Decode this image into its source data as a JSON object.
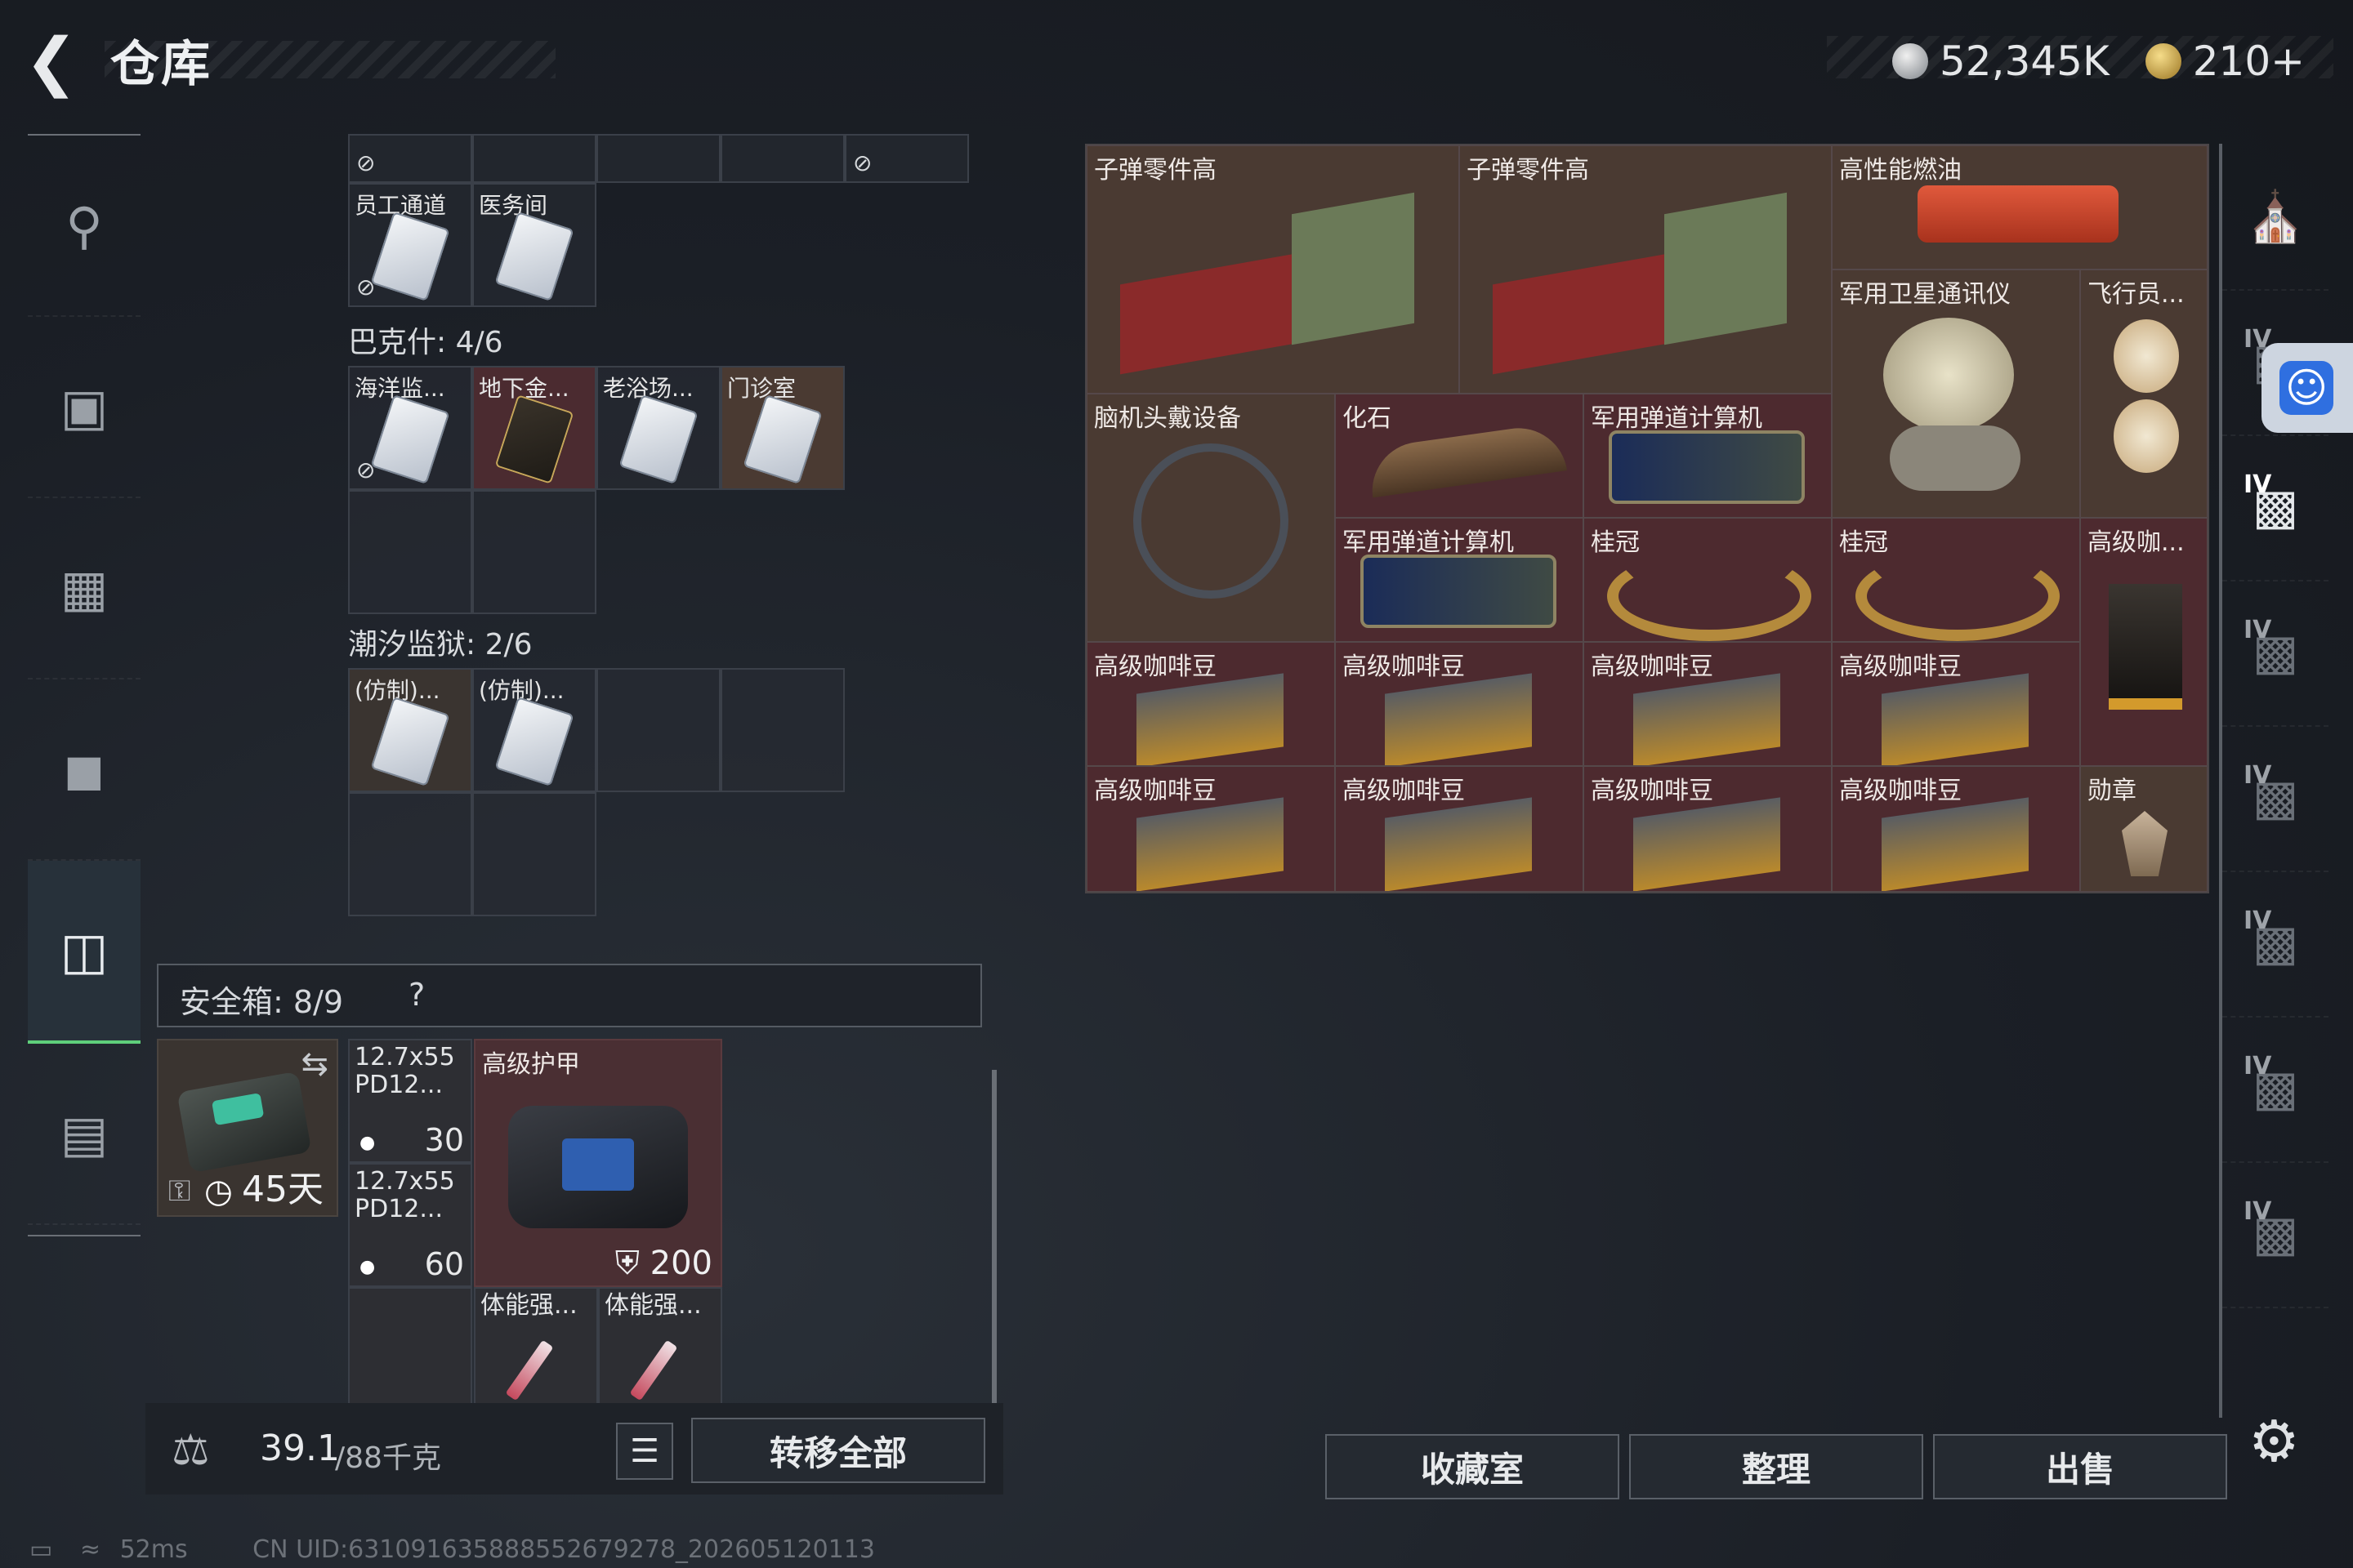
{
  "header": {
    "title": "仓库",
    "currency_silver": "52,345K",
    "currency_gold": "210+"
  },
  "left_nav": {
    "icons": [
      "rifle-icon",
      "armor-vest-icon",
      "chest-rig-icon",
      "backpack-icon",
      "storage-case-icon",
      "briefcase-icon"
    ]
  },
  "storage": {
    "row1_labels": [
      "员工通道",
      "医务间"
    ],
    "bakeshi_title": "巴克什: 4/6",
    "bakeshi_items": [
      "海洋监...",
      "地下金...",
      "老浴场...",
      "门诊室"
    ],
    "prison_title": "潮汐监狱: 2/6",
    "prison_items": [
      "(仿制)...",
      "(仿制)..."
    ]
  },
  "safe": {
    "label": "安全箱: 8/9",
    "help": "?",
    "days": "45天"
  },
  "inventory": {
    "ammo1_label": "12.7x55 PD12...",
    "ammo1_count": "30",
    "ammo2_label": "12.7x55 PD12...",
    "ammo2_count": "60",
    "armor_label": "高级护甲",
    "armor_value": "200",
    "stim1": "体能强...",
    "stim2": "体能强..."
  },
  "footer_left": {
    "weight_current": "39.1",
    "weight_max": "/88千克",
    "transfer_all": "转移全部"
  },
  "collection": {
    "items": [
      "子弹零件高",
      "子弹零件高",
      "高性能燃油",
      "军用卫星通讯仪",
      "飞行员...",
      "脑机头戴设备",
      "化石",
      "军用弹道计算机",
      "军用弹道计算机",
      "桂冠",
      "桂冠",
      "高级咖...",
      "高级咖啡豆",
      "高级咖啡豆",
      "高级咖啡豆",
      "高级咖啡豆",
      "高级咖啡豆",
      "高级咖啡豆",
      "高级咖啡豆",
      "高级咖啡豆",
      "勋章"
    ]
  },
  "right_tabs": {
    "level": "IV",
    "icons": [
      "shelter-icon",
      "vault-IV-icon",
      "vault-IV-icon",
      "vault-IV-icon",
      "vault-IV-icon",
      "vault-IV-icon",
      "vault-IV-icon",
      "vault-IV-icon"
    ]
  },
  "footer_right": {
    "collection_room": "收藏室",
    "organize": "整理",
    "sell": "出售"
  },
  "status": {
    "ping": "52ms",
    "uid": "CN UID:631091635888552679278_202605120113"
  },
  "colors": {
    "accent_green": "#5fcf7b",
    "item_red_bg": "#4d2a2f",
    "item_brown_bg": "#4a3a32"
  }
}
